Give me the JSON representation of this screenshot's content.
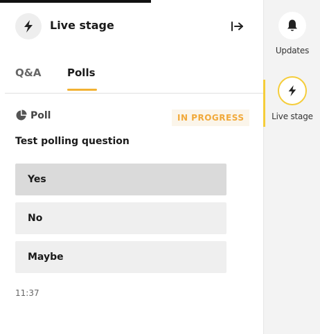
{
  "panel": {
    "title": "Live stage",
    "icons": {
      "title_icon": "lightning-bolt-icon",
      "collapse": "collapse-panel-icon"
    }
  },
  "tabs": [
    {
      "label": "Q&A",
      "active": false
    },
    {
      "label": "Polls",
      "active": true
    }
  ],
  "poll": {
    "label": "Poll",
    "label_icon": "pie-chart-icon",
    "status": "IN PROGRESS",
    "question": "Test polling question",
    "options": [
      {
        "label": "Yes",
        "selected": true
      },
      {
        "label": "No",
        "selected": false
      },
      {
        "label": "Maybe",
        "selected": false
      }
    ],
    "time": "11:37"
  },
  "rail": {
    "items": [
      {
        "label": "Updates",
        "icon": "bell-icon",
        "active": false
      },
      {
        "label": "Live stage",
        "icon": "lightning-bolt-icon",
        "active": true
      }
    ]
  },
  "colors": {
    "accent": "#f2b233",
    "status_text": "#f1a93a",
    "status_bg": "#fbf5ea",
    "rail_active": "#f5cd3a",
    "option_bg": "#efefef",
    "option_selected_bg": "#dadada"
  }
}
